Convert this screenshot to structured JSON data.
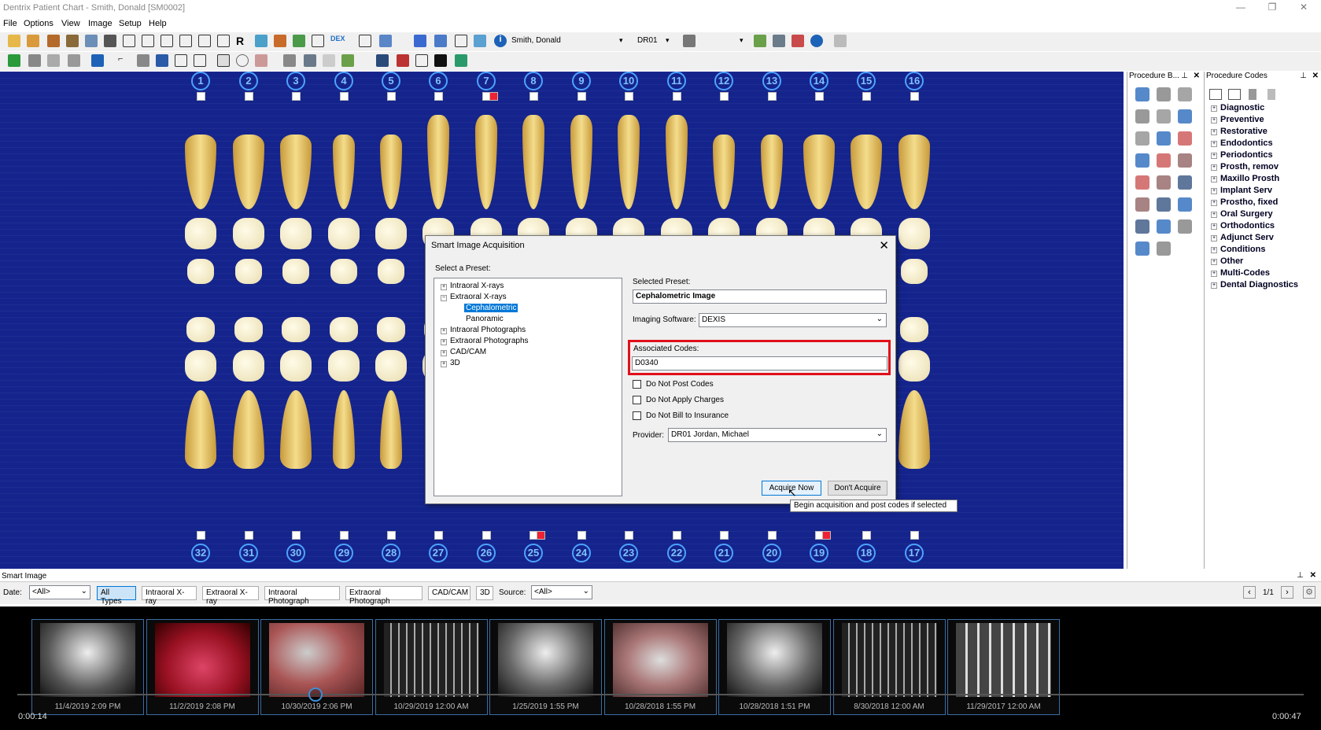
{
  "window": {
    "title": "Dentrix Patient Chart - Smith, Donald [SM0002]"
  },
  "menu": [
    "File",
    "Options",
    "View",
    "Image",
    "Setup",
    "Help"
  ],
  "toolbar": {
    "patient_name": "Smith, Donald",
    "provider_select": "DR01",
    "colors": {
      "toolbar_bg": "#f0f0f0"
    }
  },
  "chart": {
    "upper_numbers": [
      "1",
      "2",
      "3",
      "4",
      "5",
      "6",
      "7",
      "8",
      "9",
      "10",
      "11",
      "12",
      "13",
      "14",
      "15",
      "16"
    ],
    "lower_numbers": [
      "32",
      "31",
      "30",
      "29",
      "28",
      "27",
      "26",
      "25",
      "24",
      "23",
      "22",
      "21",
      "20",
      "19",
      "18",
      "17"
    ],
    "colors": {
      "background": "#14248c",
      "number_ring": "#4da3ff"
    }
  },
  "procedure_buttons": {
    "title": "Procedure B..."
  },
  "procedure_codes": {
    "title": "Procedure Codes",
    "items": [
      "Diagnostic",
      "Preventive",
      "Restorative",
      "Endodontics",
      "Periodontics",
      "Prosth, remov",
      "Maxillo Prosth",
      "Implant Serv",
      "Prostho, fixed",
      "Oral Surgery",
      "Orthodontics",
      "Adjunct Serv",
      "Conditions",
      "Other",
      "Multi-Codes",
      "Dental Diagnostics"
    ]
  },
  "dialog": {
    "title": "Smart Image Acquisition",
    "select_preset_label": "Select a Preset:",
    "tree": [
      "Intraoral X-rays",
      "Extraoral X-rays",
      "Cephalometric",
      "Panoramic",
      "Intraoral Photographs",
      "Extraoral Photographs",
      "CAD/CAM",
      "3D"
    ],
    "selected_preset_label": "Selected Preset:",
    "selected_preset_value": "Cephalometric Image",
    "imaging_software_label": "Imaging Software:",
    "imaging_software_value": "DEXIS",
    "associated_codes_label": "Associated Codes:",
    "associated_codes_value": "D0340",
    "checkboxes": [
      "Do Not Post Codes",
      "Do Not Apply Charges",
      "Do Not Bill to Insurance"
    ],
    "provider_label": "Provider:",
    "provider_value": "DR01 Jordan, Michael",
    "acquire_button": "Acquire Now",
    "dont_acquire_button": "Don't Acquire",
    "highlight_color": "#e0101a"
  },
  "tooltip": "Begin acquisition and post codes if selected",
  "smart_image": {
    "title": "Smart Image",
    "date_label": "Date:",
    "date_value": "<All>",
    "filters": [
      "All Types",
      "Intraoral X-ray",
      "Extraoral X-ray",
      "Intraoral Photograph",
      "Extraoral Photograph",
      "CAD/CAM",
      "3D"
    ],
    "source_label": "Source:",
    "source_value": "<All>",
    "page": "1/1",
    "thumbnails": [
      "11/4/2019 2:09 PM",
      "11/2/2019 2:08 PM",
      "10/30/2019 2:06 PM",
      "10/29/2019 12:00 AM",
      "1/25/2019 1:55 PM",
      "10/28/2018 1:55 PM",
      "10/28/2018 1:51 PM",
      "8/30/2018 12:00 AM",
      "11/29/2017 12:00 AM"
    ],
    "time_elapsed": "0:00:14",
    "time_total": "0:00:47"
  }
}
